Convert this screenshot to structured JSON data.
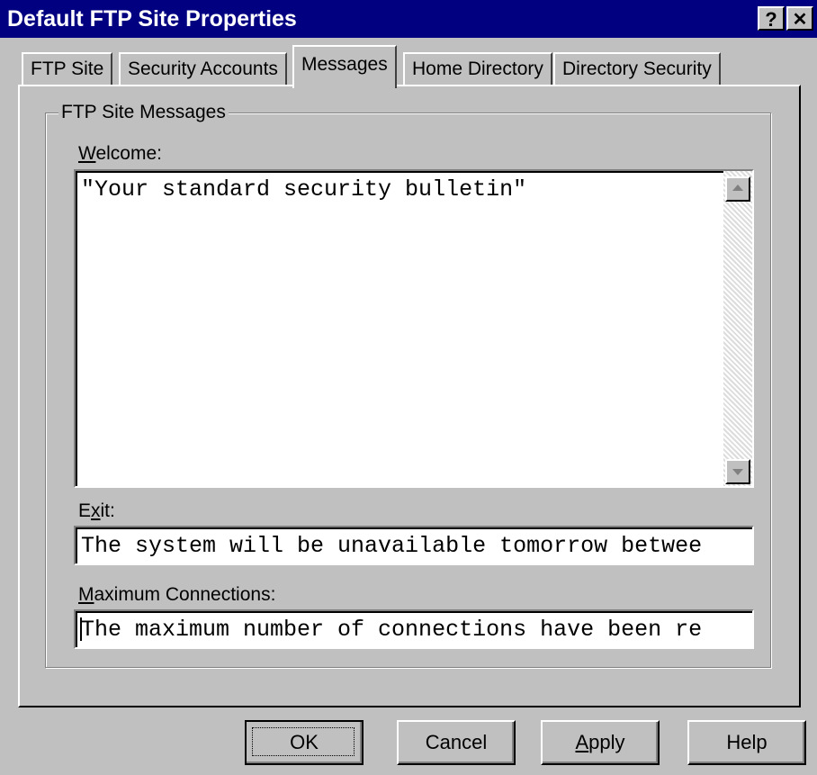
{
  "window": {
    "title": "Default FTP Site Properties",
    "help_glyph": "?",
    "close_glyph": "✕"
  },
  "tabs": [
    {
      "label": "FTP Site"
    },
    {
      "label": "Security Accounts"
    },
    {
      "label": "Messages"
    },
    {
      "label": "Home Directory"
    },
    {
      "label": "Directory Security"
    }
  ],
  "active_tab": "Messages",
  "group": {
    "title": "FTP Site Messages"
  },
  "welcome": {
    "label_underlined": "W",
    "label_rest": "elcome:",
    "value": "\"Your standard security bulletin\""
  },
  "exit": {
    "label_first": "E",
    "label_underlined": "x",
    "label_rest": "it:",
    "value": "The system will be unavailable tomorrow betwee"
  },
  "max_connections": {
    "label_underlined": "M",
    "label_rest": "aximum Connections:",
    "value": "The maximum number of connections have been re"
  },
  "buttons": {
    "ok": "OK",
    "cancel": "Cancel",
    "apply_underlined": "A",
    "apply_rest": "pply",
    "help": "Help"
  },
  "colors": {
    "titlebar": "#000080",
    "face": "#c0c0c0"
  }
}
